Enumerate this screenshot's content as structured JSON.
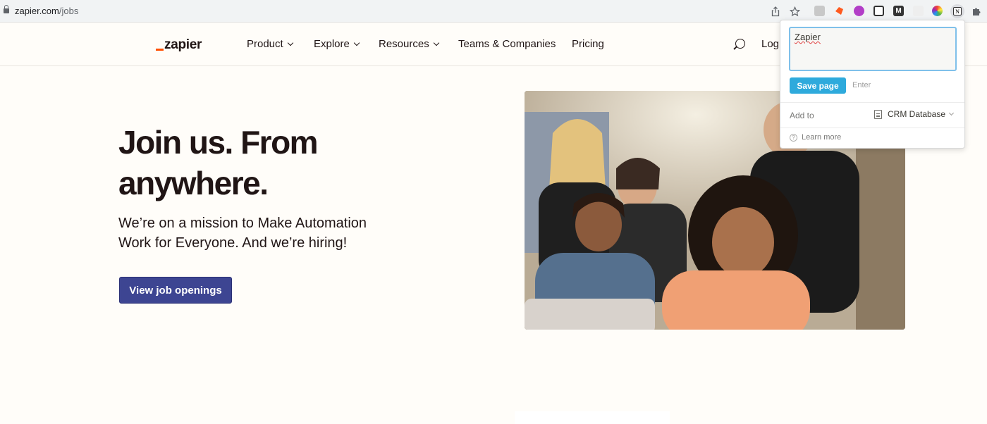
{
  "browser": {
    "url_domain": "zapier.com",
    "url_path": "/jobs",
    "icons": [
      "lock-icon",
      "share-icon",
      "bookmark-star-icon",
      "extensions-puzzle-icon"
    ],
    "extension_colors": [
      "#c8c8c8",
      "#ff5a1f",
      "#b23ec7",
      "#333333",
      "#333333",
      "#e6e6e6",
      "#4caf50",
      "#333333"
    ]
  },
  "header": {
    "logo_text": "zapier",
    "logo_accent": "#ff4f00",
    "nav": [
      {
        "label": "Product",
        "has_dropdown": true
      },
      {
        "label": "Explore",
        "has_dropdown": true
      },
      {
        "label": "Resources",
        "has_dropdown": true
      },
      {
        "label": "Teams & Companies",
        "has_dropdown": false
      },
      {
        "label": "Pricing",
        "has_dropdown": false
      }
    ],
    "login_label": "Log"
  },
  "hero": {
    "title_line1": "Join us. From",
    "title_line2": "anywhere.",
    "subtitle_line1": "We’re on a mission to Make Automation",
    "subtitle_line2": "Work for Everyone. And we’re hiring!",
    "cta_label": "View job openings",
    "cta_color": "#3d4592",
    "photo_icon": "team-photo"
  },
  "popup": {
    "title_value": "Zapier",
    "save_label": "Save page",
    "enter_hint": "Enter",
    "add_to_label": "Add to",
    "database_name": "CRM Database",
    "learn_more": "Learn more",
    "accent": "#2eaadc"
  }
}
